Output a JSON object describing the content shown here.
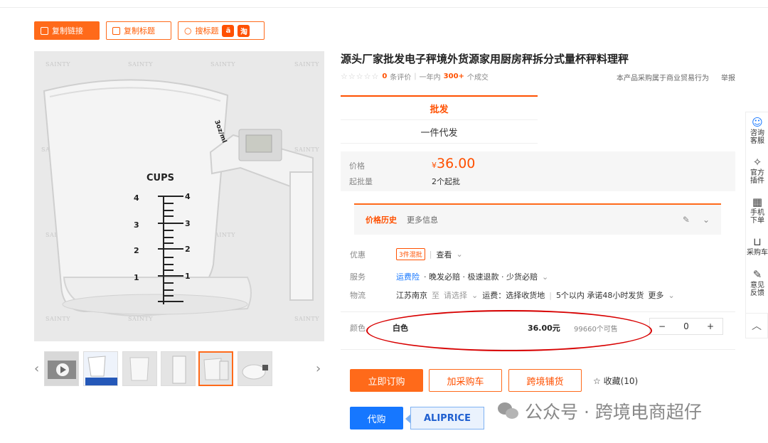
{
  "toolbar": {
    "copy_link": "复制链接",
    "copy_title": "复制标题",
    "search_title": "搜标题",
    "taobao_badge": "淘"
  },
  "gallery": {
    "watermark": "SAINTY",
    "cups_label": "CUPS",
    "scale_label": "3oz/ml",
    "thumbnails_count": 6,
    "selected_thumbnail": 5
  },
  "product": {
    "title": "源头厂家批发电子秤境外货源家用厨房秤拆分式量杯秤料理秤",
    "stars": "☆☆☆☆☆",
    "review_count": "0",
    "review_suffix": "条评价",
    "sales_prefix": "一年内",
    "sales_count": "300+",
    "sales_suffix": "个成交",
    "business_note": "本产品采购属于商业贸易行为",
    "report": "举报"
  },
  "modes": {
    "wholesale": "批发",
    "dropship": "一件代发"
  },
  "pricing": {
    "price_label": "价格",
    "currency": "¥",
    "price": "36.00",
    "moq_label": "起批量",
    "moq": "2个起批"
  },
  "history": {
    "tab_history": "价格历史",
    "tab_more": "更多信息"
  },
  "details": {
    "promo_label": "优惠",
    "promo_tag": "3件混批",
    "promo_view": "查看",
    "service_label": "服务",
    "service_link": "运费险",
    "service_text": "· 晚发必赔 · 极速退款 · 少货必赔",
    "logistics_label": "物流",
    "origin": "江苏南京",
    "to": "至",
    "choose": "请选择",
    "shipping": "运费：选择收货地",
    "delivery": "5个以内 承诺48小时发货",
    "more": "更多"
  },
  "variant": {
    "label": "颜色",
    "name": "白色",
    "price": "36.00元",
    "stock": "99660个可售",
    "minus": "−",
    "qty": "0",
    "plus": "+"
  },
  "actions": {
    "buy_now": "立即订购",
    "add_cart": "加采购车",
    "cross_border": "跨境铺货",
    "favorite": "收藏(10)",
    "proxy": "代购",
    "aliprice": "ALIPRICE"
  },
  "overlay": {
    "wechat_text": "公众号 · 跨境电商超仔"
  },
  "sidebar": {
    "items": [
      {
        "label": "咨询客服",
        "line1": "咨询",
        "line2": "客服"
      },
      {
        "label": "官方插件",
        "line1": "官方",
        "line2": "插件"
      },
      {
        "label": "手机下单",
        "line1": "手机",
        "line2": "下单"
      },
      {
        "label": "采购车",
        "line1": "采购车",
        "line2": ""
      },
      {
        "label": "意见反馈",
        "line1": "意见",
        "line2": "反馈"
      }
    ]
  },
  "colors": {
    "accent": "#ff6a1a",
    "price": "#ff5000",
    "link": "#1677ff",
    "circle": "#d80000"
  }
}
